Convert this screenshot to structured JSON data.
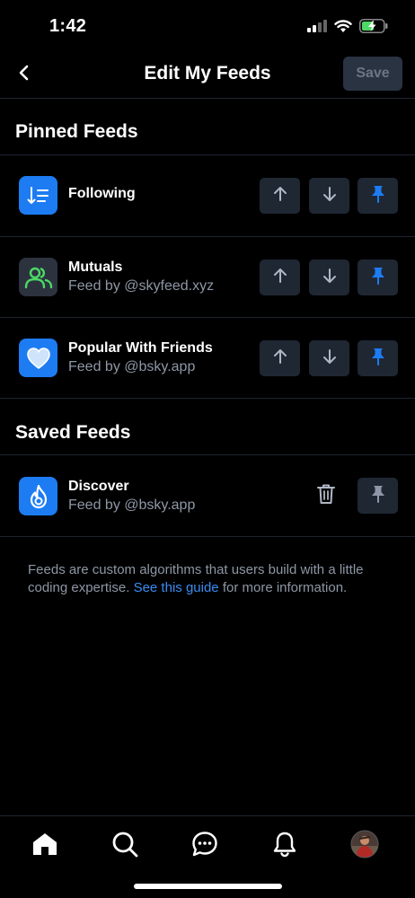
{
  "status_bar": {
    "time": "1:42",
    "icons": [
      "signal-icon",
      "wifi-icon",
      "battery-charging-icon"
    ]
  },
  "header": {
    "back_icon": "chevron-left-icon",
    "title": "Edit My Feeds",
    "save_label": "Save"
  },
  "pinned": {
    "title": "Pinned Feeds",
    "feeds": [
      {
        "name": "Following",
        "subtitle": "",
        "icon": "following-list-icon",
        "color": "#1d7cf2"
      },
      {
        "name": "Mutuals",
        "subtitle": "Feed by @skyfeed.xyz",
        "icon": "mutuals-people-icon",
        "color": "#2c333f"
      },
      {
        "name": "Popular With Friends",
        "subtitle": "Feed by @bsky.app",
        "icon": "heart-icon",
        "color": "#1d7cf2"
      }
    ],
    "controls": [
      "arrow-up-icon",
      "arrow-down-icon",
      "pin-icon"
    ]
  },
  "saved": {
    "title": "Saved Feeds",
    "feeds": [
      {
        "name": "Discover",
        "subtitle": "Feed by @bsky.app",
        "icon": "flame-icon",
        "color": "#1d7cf2"
      }
    ],
    "controls": [
      "trash-icon",
      "pin-icon"
    ]
  },
  "info": {
    "text_before": "Feeds are custom algorithms that users build with a little coding expertise. ",
    "link": "See this guide",
    "text_after": " for more information."
  },
  "bottom_nav": [
    "home-icon",
    "search-icon",
    "chat-icon",
    "bell-icon",
    "profile-avatar"
  ],
  "colors": {
    "accent": "#1d7cf2",
    "link": "#3b8cf3",
    "button_bg": "#1f2733",
    "muted_text": "#8d97a5",
    "divider": "#1e2430"
  }
}
